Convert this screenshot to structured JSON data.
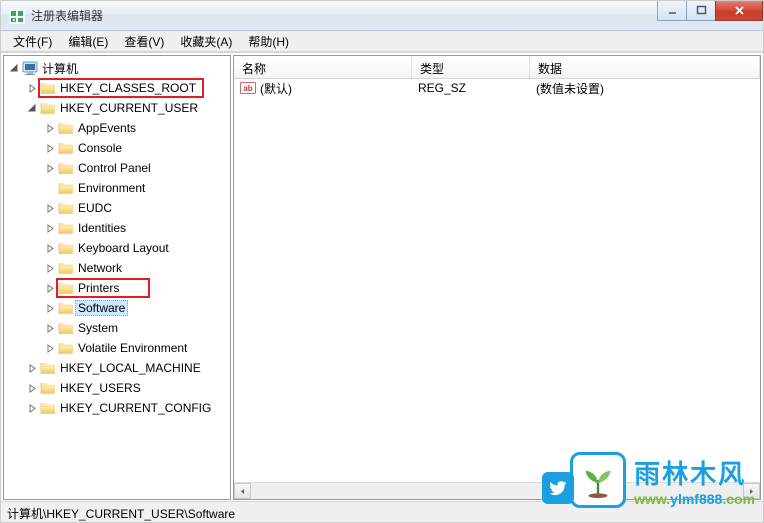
{
  "title": "注册表编辑器",
  "menu": {
    "file": "文件(F)",
    "edit": "编辑(E)",
    "view": "查看(V)",
    "favorites": "收藏夹(A)",
    "help": "帮助(H)"
  },
  "tree": {
    "root": "计算机",
    "hives": {
      "hkcr": "HKEY_CLASSES_ROOT",
      "hkcu": "HKEY_CURRENT_USER",
      "hklm": "HKEY_LOCAL_MACHINE",
      "hku": "HKEY_USERS",
      "hkcc": "HKEY_CURRENT_CONFIG"
    },
    "hkcu_children": {
      "appevents": "AppEvents",
      "console": "Console",
      "controlpanel": "Control Panel",
      "environment": "Environment",
      "eudc": "EUDC",
      "identities": "Identities",
      "keyboard": "Keyboard Layout",
      "network": "Network",
      "printers": "Printers",
      "software": "Software",
      "system": "System",
      "volatile": "Volatile Environment"
    }
  },
  "list": {
    "columns": {
      "name": "名称",
      "type": "类型",
      "data": "数据"
    },
    "rows": [
      {
        "name": "(默认)",
        "type": "REG_SZ",
        "data": "(数值未设置)"
      }
    ]
  },
  "statusbar": "计算机\\HKEY_CURRENT_USER\\Software",
  "watermark": {
    "cn": "雨林木风",
    "url_prefix": "www.",
    "url_mid": "ylmf888",
    "url_suffix": ".com"
  }
}
